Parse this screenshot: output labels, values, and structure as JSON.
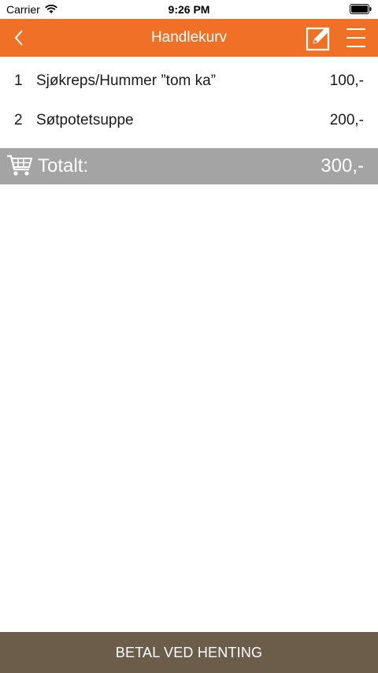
{
  "status_bar": {
    "carrier": "Carrier",
    "time": "9:26 PM"
  },
  "nav": {
    "title": "Handlekurv",
    "back_icon": "chevron-left-icon",
    "edit_icon": "edit-icon",
    "menu_icon": "hamburger-menu-icon"
  },
  "cart": {
    "items": [
      {
        "index": "1",
        "name": "Sjøkreps/Hummer ”tom ka”",
        "price": "100,-"
      },
      {
        "index": "2",
        "name": "Søtpotetsuppe",
        "price": "200,-"
      }
    ],
    "total_label": "Totalt:",
    "total_value": "300,-"
  },
  "footer": {
    "pay_label": "BETAL VED HENTING"
  },
  "colors": {
    "nav_bg": "#f07126",
    "total_bg": "#a4a4a4",
    "pay_bg": "#6c5d4b"
  }
}
